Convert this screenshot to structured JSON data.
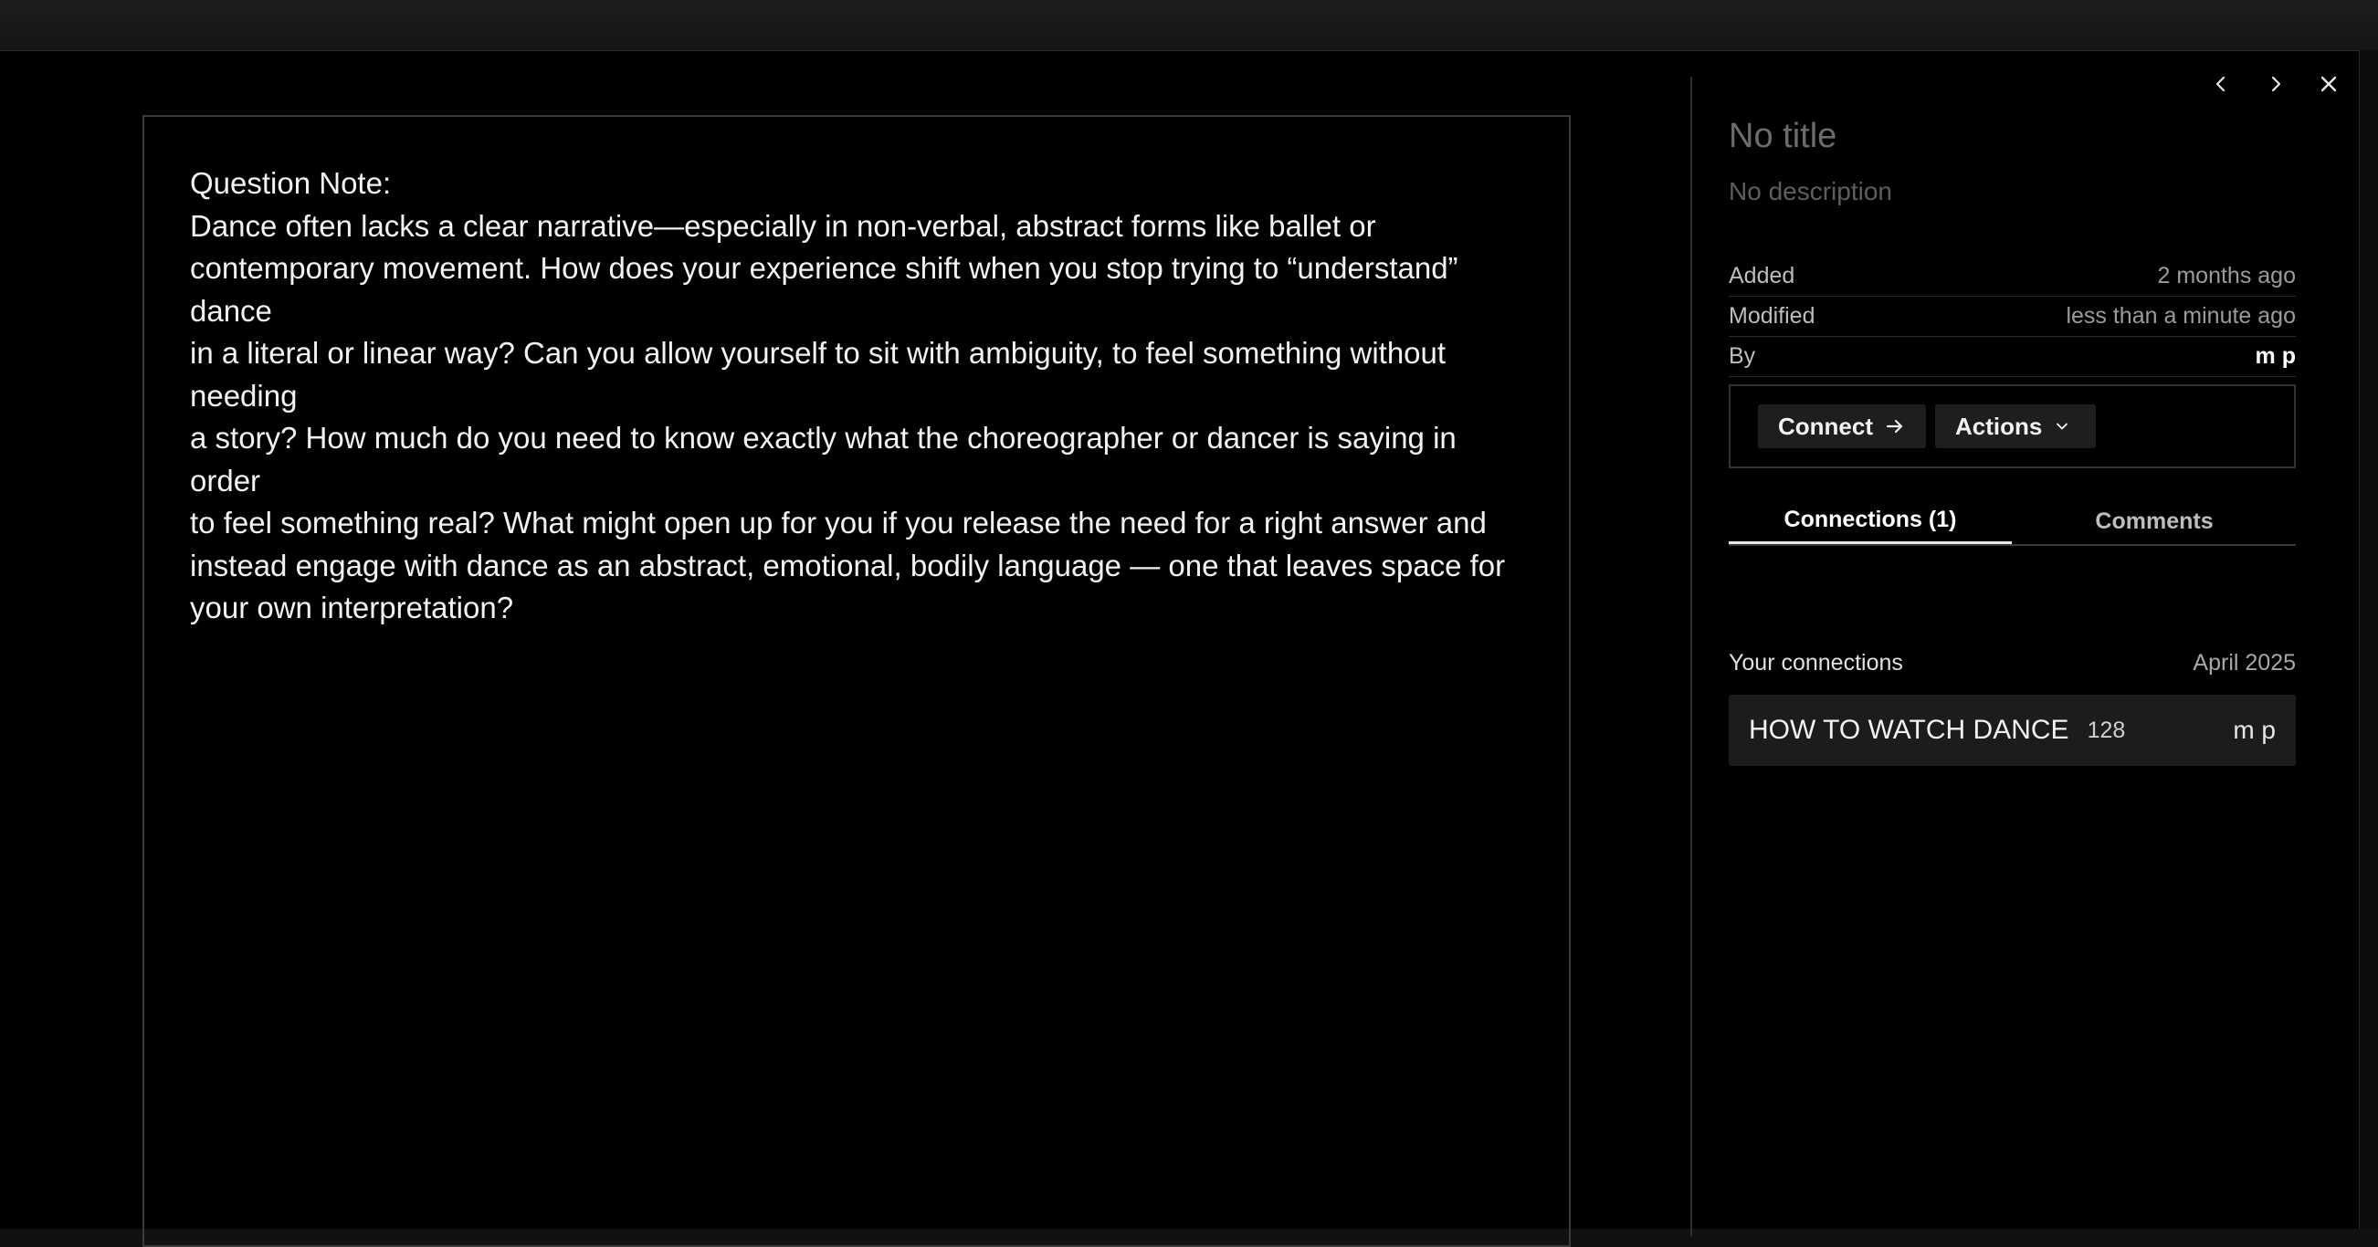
{
  "note": {
    "text": "Question Note:\nDance often lacks a clear narrative—especially in non-verbal, abstract forms like ballet or\ncontemporary movement. How does your experience shift when you stop trying to “understand” dance\nin a literal or linear way? Can you allow yourself to sit with ambiguity, to feel something without needing\na story? How much do you need to know exactly what the choreographer or dancer is saying in order\nto feel something real? What might open up for you if you release the need for a right answer and\ninstead engage with dance as an abstract, emotional, bodily language — one that leaves space for\nyour own interpretation?"
  },
  "block": {
    "title": "No title",
    "description": "No description"
  },
  "meta": [
    {
      "label": "Added",
      "value": "2 months ago"
    },
    {
      "label": "Modified",
      "value": "less than a minute ago"
    },
    {
      "label": "By",
      "value": "m p"
    }
  ],
  "actions": {
    "connect_label": "Connect",
    "actions_label": "Actions"
  },
  "tabs": [
    {
      "label": "Connections (1)"
    },
    {
      "label": "Comments"
    }
  ],
  "connections": {
    "header_label": "Your connections",
    "header_date": "April 2025",
    "items": [
      {
        "name": "HOW TO WATCH DANCE",
        "count": "128",
        "owner": "m p"
      }
    ]
  },
  "icons": {
    "prev": "chevron-left-icon",
    "next": "chevron-right-icon",
    "close": "close-icon",
    "connect": "arrow-right-icon",
    "actions": "chevron-down-icon"
  }
}
